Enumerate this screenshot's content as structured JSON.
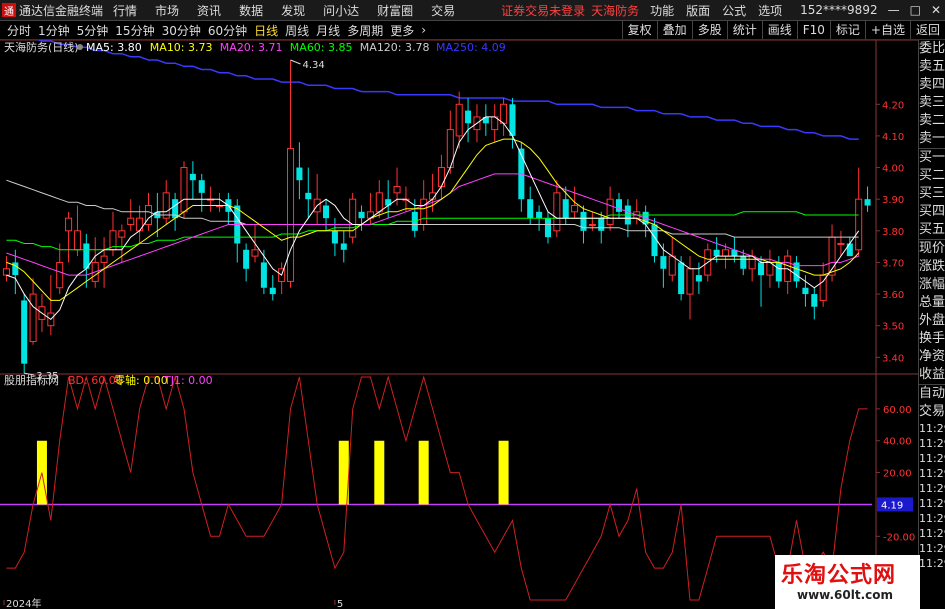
{
  "app": {
    "title": "通达信金融终端",
    "menu": [
      "行情",
      "市场",
      "资讯",
      "数据",
      "发现",
      "问小达",
      "财富圈",
      "交易"
    ],
    "warn1": "证券交易未登录",
    "warn2": "天海防务",
    "right_menu": [
      "功能",
      "版面",
      "公式",
      "选项"
    ],
    "user": "152****9892",
    "win": "R"
  },
  "tabs": [
    "分时",
    "1分钟",
    "5分钟",
    "15分钟",
    "30分钟",
    "60分钟",
    "日线",
    "周线",
    "月线",
    "多周期",
    "更多"
  ],
  "active_tab": "日线",
  "tools": [
    "复权",
    "叠加",
    "多股",
    "统计",
    "画线",
    "F10",
    "标记",
    "+自选",
    "返回"
  ],
  "main": {
    "stock": "天海防务(日线)",
    "ma": [
      {
        "label": "MA5: 3.80",
        "color": "#ffffff"
      },
      {
        "label": "MA10: 3.73",
        "color": "#ffff00"
      },
      {
        "label": "MA20: 3.71",
        "color": "#ff40ff"
      },
      {
        "label": "MA60: 3.85",
        "color": "#00ff00"
      },
      {
        "label": "MA120: 3.78",
        "color": "#cccccc"
      },
      {
        "label": "MA250: 4.09",
        "color": "#3838ff"
      }
    ],
    "yticks": [
      "4.20",
      "4.10",
      "4.00",
      "3.90",
      "3.80",
      "3.70",
      "3.60",
      "3.50",
      "3.40"
    ],
    "high": "4.34",
    "low": "3.35"
  },
  "sub": {
    "name": "股朋指标网",
    "bd": "BD: 60.00",
    "zero": "零轴: 0.00",
    "tj": "TJ1: 0.00",
    "yticks": [
      "60.00",
      "40.00",
      "20.00",
      "-20.00",
      "-40.00"
    ],
    "cur": "4.19"
  },
  "xaxis": [
    "2024年",
    "5",
    "6",
    "7"
  ],
  "right_panel": [
    "委比",
    "卖五",
    "卖四",
    "卖三",
    "卖二",
    "卖一",
    "买一",
    "买二",
    "买三",
    "买四",
    "买五",
    "现价",
    "涨跌",
    "涨幅",
    "总量",
    "外盘",
    "换手",
    "净资",
    "收益"
  ],
  "right_sub": [
    "自动",
    "交易",
    "11:29",
    "11:29",
    "11:29",
    "11:29",
    "11:29",
    "11:29",
    "11:29",
    "11:29",
    "11:29",
    "11:29"
  ],
  "watermark": {
    "line1": "乐淘公式网",
    "line2": "www.60lt.com"
  },
  "colors": {
    "up": "#ff3232",
    "down": "#00e4e4",
    "signal": "#ffff00"
  },
  "chart_data": {
    "type": "candlestick",
    "candles": [
      [
        3.66,
        3.68,
        3.72,
        3.64
      ],
      [
        3.7,
        3.66,
        3.74,
        3.6
      ],
      [
        3.58,
        3.38,
        3.6,
        3.35
      ],
      [
        3.45,
        3.6,
        3.65,
        3.44
      ],
      [
        3.52,
        3.56,
        3.6,
        3.48
      ],
      [
        3.5,
        3.54,
        3.66,
        3.47
      ],
      [
        3.62,
        3.7,
        3.76,
        3.6
      ],
      [
        3.8,
        3.84,
        3.86,
        3.7
      ],
      [
        3.74,
        3.8,
        3.88,
        3.72
      ],
      [
        3.76,
        3.68,
        3.79,
        3.62
      ],
      [
        3.64,
        3.7,
        3.78,
        3.62
      ],
      [
        3.7,
        3.72,
        3.78,
        3.62
      ],
      [
        3.74,
        3.8,
        3.86,
        3.72
      ],
      [
        3.78,
        3.8,
        3.82,
        3.7
      ],
      [
        3.82,
        3.84,
        3.9,
        3.8
      ],
      [
        3.8,
        3.84,
        3.88,
        3.76
      ],
      [
        3.82,
        3.88,
        3.92,
        3.8
      ],
      [
        3.86,
        3.84,
        3.92,
        3.78
      ],
      [
        3.84,
        3.92,
        3.96,
        3.82
      ],
      [
        3.9,
        3.84,
        3.92,
        3.8
      ],
      [
        3.86,
        4.0,
        4.02,
        3.84
      ],
      [
        3.98,
        3.96,
        4.02,
        3.9
      ],
      [
        3.96,
        3.92,
        3.98,
        3.86
      ],
      [
        3.9,
        3.9,
        3.94,
        3.86
      ],
      [
        3.88,
        3.88,
        3.92,
        3.86
      ],
      [
        3.9,
        3.86,
        3.92,
        3.82
      ],
      [
        3.88,
        3.76,
        3.9,
        3.7
      ],
      [
        3.74,
        3.68,
        3.76,
        3.64
      ],
      [
        3.72,
        3.74,
        3.82,
        3.7
      ],
      [
        3.7,
        3.62,
        3.74,
        3.6
      ],
      [
        3.62,
        3.6,
        3.66,
        3.58
      ],
      [
        3.64,
        3.68,
        3.7,
        3.6
      ],
      [
        3.64,
        4.06,
        4.34,
        3.62
      ],
      [
        4.0,
        3.96,
        4.08,
        3.9
      ],
      [
        3.92,
        3.9,
        4.0,
        3.84
      ],
      [
        3.86,
        3.9,
        3.98,
        3.82
      ],
      [
        3.88,
        3.84,
        3.9,
        3.8
      ],
      [
        3.8,
        3.76,
        3.84,
        3.72
      ],
      [
        3.76,
        3.74,
        3.8,
        3.7
      ],
      [
        3.78,
        3.9,
        3.92,
        3.76
      ],
      [
        3.86,
        3.84,
        3.88,
        3.8
      ],
      [
        3.84,
        3.86,
        3.92,
        3.82
      ],
      [
        3.86,
        3.92,
        3.96,
        3.84
      ],
      [
        3.9,
        3.88,
        3.96,
        3.84
      ],
      [
        3.92,
        3.94,
        4.0,
        3.88
      ],
      [
        3.9,
        3.9,
        3.94,
        3.86
      ],
      [
        3.86,
        3.8,
        3.9,
        3.78
      ],
      [
        3.82,
        3.9,
        3.96,
        3.8
      ],
      [
        3.9,
        3.92,
        3.98,
        3.86
      ],
      [
        3.94,
        4.0,
        4.04,
        3.9
      ],
      [
        4.0,
        4.12,
        4.18,
        3.98
      ],
      [
        4.1,
        4.2,
        4.24,
        4.06
      ],
      [
        4.18,
        4.14,
        4.22,
        4.08
      ],
      [
        4.12,
        4.16,
        4.2,
        4.08
      ],
      [
        4.16,
        4.14,
        4.2,
        4.1
      ],
      [
        4.12,
        4.16,
        4.2,
        4.08
      ],
      [
        4.14,
        4.2,
        4.22,
        4.1
      ],
      [
        4.2,
        4.1,
        4.22,
        4.06
      ],
      [
        4.06,
        3.9,
        4.08,
        3.86
      ],
      [
        3.9,
        3.84,
        3.94,
        3.82
      ],
      [
        3.86,
        3.84,
        3.88,
        3.8
      ],
      [
        3.84,
        3.78,
        3.86,
        3.76
      ],
      [
        3.8,
        3.92,
        3.96,
        3.78
      ],
      [
        3.9,
        3.84,
        3.94,
        3.82
      ],
      [
        3.86,
        3.88,
        3.94,
        3.84
      ],
      [
        3.86,
        3.8,
        3.88,
        3.76
      ],
      [
        3.82,
        3.82,
        3.86,
        3.8
      ],
      [
        3.84,
        3.8,
        3.86,
        3.76
      ],
      [
        3.82,
        3.9,
        3.94,
        3.8
      ],
      [
        3.9,
        3.86,
        3.92,
        3.84
      ],
      [
        3.88,
        3.82,
        3.9,
        3.78
      ],
      [
        3.84,
        3.86,
        3.9,
        3.82
      ],
      [
        3.86,
        3.82,
        3.88,
        3.78
      ],
      [
        3.82,
        3.72,
        3.84,
        3.7
      ],
      [
        3.72,
        3.68,
        3.76,
        3.62
      ],
      [
        3.66,
        3.72,
        3.78,
        3.64
      ],
      [
        3.7,
        3.6,
        3.72,
        3.58
      ],
      [
        3.6,
        3.68,
        3.72,
        3.52
      ],
      [
        3.66,
        3.64,
        3.7,
        3.6
      ],
      [
        3.66,
        3.74,
        3.76,
        3.64
      ],
      [
        3.74,
        3.72,
        3.78,
        3.7
      ],
      [
        3.72,
        3.74,
        3.76,
        3.68
      ],
      [
        3.74,
        3.72,
        3.78,
        3.7
      ],
      [
        3.72,
        3.68,
        3.74,
        3.66
      ],
      [
        3.68,
        3.72,
        3.74,
        3.64
      ],
      [
        3.7,
        3.66,
        3.72,
        3.56
      ],
      [
        3.66,
        3.7,
        3.74,
        3.62
      ],
      [
        3.7,
        3.64,
        3.72,
        3.62
      ],
      [
        3.64,
        3.72,
        3.74,
        3.6
      ],
      [
        3.7,
        3.64,
        3.72,
        3.62
      ],
      [
        3.62,
        3.6,
        3.66,
        3.56
      ],
      [
        3.6,
        3.56,
        3.62,
        3.52
      ],
      [
        3.58,
        3.66,
        3.7,
        3.56
      ],
      [
        3.66,
        3.78,
        3.82,
        3.64
      ],
      [
        3.76,
        3.76,
        3.8,
        3.72
      ],
      [
        3.76,
        3.72,
        3.78,
        3.72
      ],
      [
        3.74,
        3.9,
        4.0,
        3.72
      ],
      [
        3.9,
        3.88,
        3.94,
        3.86
      ]
    ],
    "ma": {
      "MA5": [
        3.66,
        3.65,
        3.6,
        3.56,
        3.54,
        3.52,
        3.55,
        3.62,
        3.66,
        3.68,
        3.72,
        3.74,
        3.74,
        3.74,
        3.78,
        3.8,
        3.84,
        3.86,
        3.86,
        3.88,
        3.9,
        3.9,
        3.9,
        3.9,
        3.9,
        3.88,
        3.84,
        3.8,
        3.76,
        3.72,
        3.68,
        3.66,
        3.74,
        3.8,
        3.84,
        3.88,
        3.9,
        3.88,
        3.84,
        3.82,
        3.82,
        3.84,
        3.86,
        3.88,
        3.9,
        3.9,
        3.88,
        3.88,
        3.9,
        3.94,
        4.0,
        4.08,
        4.12,
        4.14,
        4.16,
        4.16,
        4.14,
        4.1,
        4.04,
        3.98,
        3.92,
        3.86,
        3.84,
        3.84,
        3.84,
        3.84,
        3.84,
        3.84,
        3.84,
        3.84,
        3.84,
        3.84,
        3.82,
        3.78,
        3.74,
        3.72,
        3.7,
        3.68,
        3.68,
        3.7,
        3.72,
        3.72,
        3.72,
        3.72,
        3.72,
        3.7,
        3.7,
        3.68,
        3.68,
        3.66,
        3.64,
        3.62,
        3.64,
        3.68,
        3.72,
        3.76,
        3.8
      ],
      "MA10": [
        3.7,
        3.69,
        3.67,
        3.64,
        3.61,
        3.58,
        3.58,
        3.6,
        3.62,
        3.64,
        3.66,
        3.68,
        3.7,
        3.72,
        3.74,
        3.76,
        3.78,
        3.8,
        3.82,
        3.84,
        3.86,
        3.88,
        3.88,
        3.88,
        3.88,
        3.88,
        3.87,
        3.85,
        3.83,
        3.81,
        3.79,
        3.77,
        3.78,
        3.78,
        3.79,
        3.8,
        3.8,
        3.8,
        3.8,
        3.8,
        3.82,
        3.84,
        3.85,
        3.86,
        3.86,
        3.87,
        3.87,
        3.87,
        3.88,
        3.9,
        3.92,
        3.96,
        4.0,
        4.04,
        4.07,
        4.08,
        4.09,
        4.09,
        4.08,
        4.06,
        4.03,
        3.99,
        3.95,
        3.92,
        3.89,
        3.87,
        3.86,
        3.85,
        3.84,
        3.84,
        3.84,
        3.84,
        3.83,
        3.82,
        3.8,
        3.78,
        3.76,
        3.74,
        3.72,
        3.71,
        3.71,
        3.71,
        3.71,
        3.71,
        3.71,
        3.71,
        3.7,
        3.7,
        3.69,
        3.68,
        3.67,
        3.66,
        3.66,
        3.67,
        3.68,
        3.7,
        3.73
      ],
      "MA20": [
        3.73,
        3.72,
        3.71,
        3.7,
        3.69,
        3.68,
        3.67,
        3.66,
        3.66,
        3.66,
        3.67,
        3.68,
        3.69,
        3.7,
        3.71,
        3.72,
        3.73,
        3.74,
        3.75,
        3.76,
        3.77,
        3.78,
        3.79,
        3.8,
        3.81,
        3.82,
        3.82,
        3.82,
        3.82,
        3.82,
        3.82,
        3.82,
        3.82,
        3.82,
        3.82,
        3.82,
        3.82,
        3.82,
        3.82,
        3.82,
        3.82,
        3.82,
        3.83,
        3.84,
        3.85,
        3.86,
        3.87,
        3.88,
        3.89,
        3.9,
        3.92,
        3.94,
        3.95,
        3.96,
        3.97,
        3.98,
        3.98,
        3.98,
        3.98,
        3.97,
        3.96,
        3.95,
        3.94,
        3.93,
        3.92,
        3.91,
        3.9,
        3.89,
        3.88,
        3.87,
        3.86,
        3.85,
        3.84,
        3.83,
        3.82,
        3.81,
        3.8,
        3.79,
        3.78,
        3.77,
        3.76,
        3.75,
        3.74,
        3.73,
        3.72,
        3.71,
        3.71,
        3.7,
        3.7,
        3.69,
        3.69,
        3.69,
        3.69,
        3.7,
        3.7,
        3.71,
        3.72
      ],
      "MA60": [
        3.77,
        3.77,
        3.76,
        3.76,
        3.75,
        3.75,
        3.74,
        3.74,
        3.74,
        3.74,
        3.74,
        3.74,
        3.75,
        3.75,
        3.75,
        3.76,
        3.76,
        3.77,
        3.77,
        3.77,
        3.78,
        3.78,
        3.78,
        3.78,
        3.78,
        3.78,
        3.78,
        3.78,
        3.78,
        3.78,
        3.78,
        3.79,
        3.79,
        3.79,
        3.8,
        3.8,
        3.8,
        3.81,
        3.81,
        3.81,
        3.82,
        3.82,
        3.82,
        3.82,
        3.83,
        3.83,
        3.83,
        3.84,
        3.84,
        3.84,
        3.84,
        3.84,
        3.84,
        3.84,
        3.84,
        3.84,
        3.84,
        3.84,
        3.84,
        3.84,
        3.84,
        3.84,
        3.84,
        3.84,
        3.84,
        3.84,
        3.84,
        3.84,
        3.85,
        3.85,
        3.85,
        3.85,
        3.85,
        3.85,
        3.85,
        3.85,
        3.85,
        3.85,
        3.85,
        3.85,
        3.85,
        3.85,
        3.85,
        3.86,
        3.86,
        3.86,
        3.86,
        3.86,
        3.86,
        3.86,
        3.85,
        3.85,
        3.85,
        3.85,
        3.85,
        3.85,
        3.85
      ],
      "MA120": [
        3.96,
        3.95,
        3.94,
        3.93,
        3.92,
        3.91,
        3.9,
        3.89,
        3.89,
        3.88,
        3.88,
        3.87,
        3.87,
        3.86,
        3.86,
        3.86,
        3.86,
        3.85,
        3.85,
        3.85,
        3.84,
        3.84,
        3.84,
        3.83,
        3.83,
        3.83,
        3.83,
        3.82,
        3.82,
        3.82,
        3.82,
        3.82,
        3.82,
        3.82,
        3.82,
        3.82,
        3.82,
        3.82,
        3.82,
        3.82,
        3.82,
        3.82,
        3.82,
        3.82,
        3.82,
        3.82,
        3.82,
        3.82,
        3.82,
        3.82,
        3.82,
        3.82,
        3.82,
        3.82,
        3.82,
        3.82,
        3.82,
        3.82,
        3.82,
        3.82,
        3.82,
        3.82,
        3.82,
        3.82,
        3.82,
        3.81,
        3.81,
        3.81,
        3.81,
        3.81,
        3.8,
        3.8,
        3.8,
        3.8,
        3.8,
        3.79,
        3.79,
        3.79,
        3.79,
        3.79,
        3.79,
        3.79,
        3.78,
        3.78,
        3.78,
        3.78,
        3.78,
        3.78,
        3.78,
        3.78,
        3.78,
        3.78,
        3.78,
        3.78,
        3.78,
        3.78,
        3.78
      ],
      "MA250": [
        4.42,
        4.42,
        4.41,
        4.41,
        4.4,
        4.4,
        4.39,
        4.39,
        4.38,
        4.38,
        4.37,
        4.37,
        4.36,
        4.36,
        4.35,
        4.35,
        4.34,
        4.34,
        4.33,
        4.33,
        4.32,
        4.32,
        4.31,
        4.31,
        4.3,
        4.3,
        4.29,
        4.29,
        4.28,
        4.28,
        4.28,
        4.27,
        4.27,
        4.27,
        4.26,
        4.26,
        4.26,
        4.25,
        4.25,
        4.25,
        4.24,
        4.24,
        4.24,
        4.24,
        4.23,
        4.23,
        4.23,
        4.23,
        4.23,
        4.23,
        4.23,
        4.22,
        4.22,
        4.22,
        4.22,
        4.22,
        4.22,
        4.21,
        4.21,
        4.21,
        4.21,
        4.21,
        4.2,
        4.2,
        4.2,
        4.2,
        4.2,
        4.19,
        4.19,
        4.19,
        4.19,
        4.18,
        4.18,
        4.18,
        4.17,
        4.17,
        4.17,
        4.16,
        4.16,
        4.16,
        4.15,
        4.15,
        4.15,
        4.14,
        4.14,
        4.13,
        4.13,
        4.13,
        4.12,
        4.12,
        4.11,
        4.11,
        4.1,
        4.1,
        4.1,
        4.09,
        4.09
      ]
    },
    "ylim": [
      3.36,
      4.34
    ],
    "indicator": [
      -40,
      -40,
      -30,
      0,
      20,
      -10,
      40,
      80,
      60,
      80,
      60,
      80,
      60,
      40,
      20,
      60,
      80,
      80,
      60,
      80,
      60,
      20,
      0,
      -20,
      -20,
      0,
      -10,
      -20,
      -20,
      -20,
      -10,
      0,
      60,
      80,
      40,
      0,
      -20,
      -40,
      -30,
      60,
      80,
      80,
      60,
      80,
      60,
      40,
      60,
      80,
      60,
      40,
      20,
      20,
      0,
      -10,
      -20,
      -30,
      -20,
      -10,
      -40,
      -60,
      -60,
      -60,
      -60,
      -60,
      -50,
      -40,
      -30,
      -20,
      0,
      -20,
      -10,
      10,
      -30,
      -40,
      -40,
      -30,
      0,
      -60,
      -60,
      -40,
      -20,
      -20,
      -20,
      -20,
      -20,
      -20,
      -20,
      -40,
      -40,
      -10,
      -40,
      -40,
      -30,
      -40,
      10,
      40,
      60,
      60
    ],
    "indicator_ylim": [
      -60,
      75
    ],
    "signals": [
      4,
      38,
      42,
      47,
      56
    ]
  }
}
